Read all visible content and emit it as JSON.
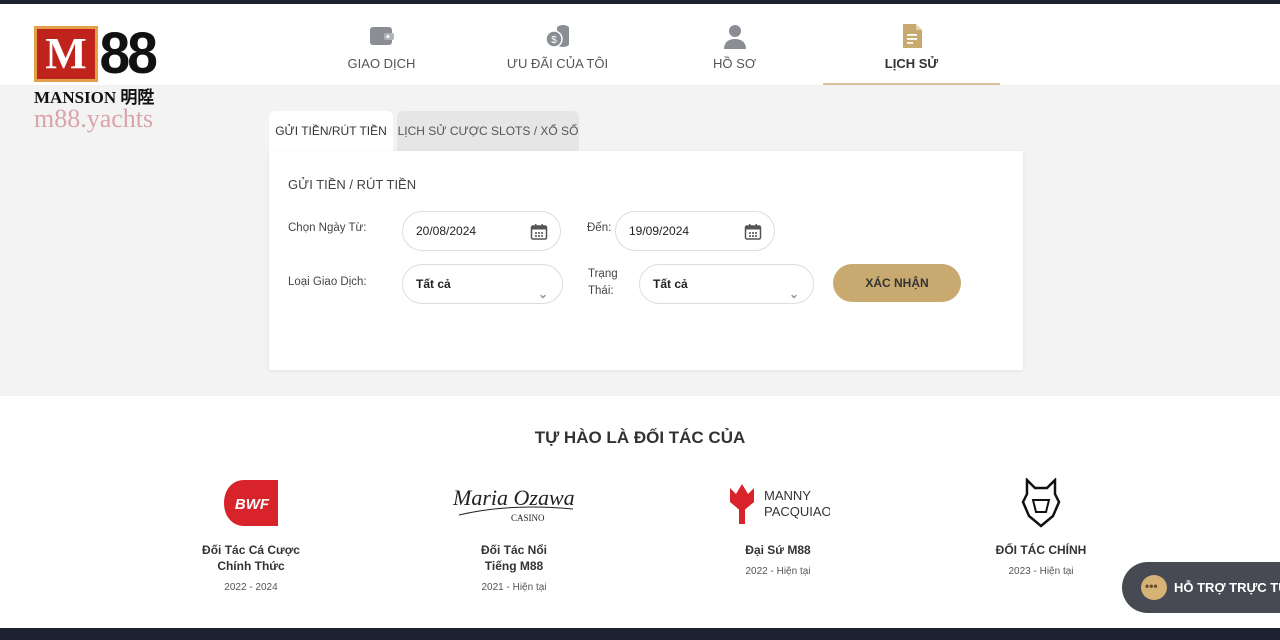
{
  "brand": {
    "logo_text": "M88",
    "sub": "MANSION 明陞",
    "url": "m88.yachts"
  },
  "nav": [
    {
      "label": "GIAO DỊCH",
      "icon": "wallet-icon"
    },
    {
      "label": "ƯU ĐÃI CỦA TÔI",
      "icon": "coins-icon"
    },
    {
      "label": "HỒ SƠ",
      "icon": "user-icon"
    },
    {
      "label": "LỊCH SỬ",
      "icon": "document-icon",
      "active": true
    }
  ],
  "tabs": [
    {
      "label": "GỬI TIỀN/RÚT TIỀN",
      "active": true
    },
    {
      "label": "LỊCH SỬ CƯỢC SLOTS / XỔ SỐ"
    }
  ],
  "form": {
    "title": "GỬI TIỀN / RÚT TIỀN",
    "from_label": "Chọn Ngày Từ:",
    "from_value": "20/08/2024",
    "to_label": "Đến:",
    "to_value": "19/09/2024",
    "type_label": "Loại Giao Dịch:",
    "type_value": "Tất cả",
    "status_label_1": "Trạng",
    "status_label_2": "Thái:",
    "status_value": "Tất cả",
    "submit": "XÁC NHẬN"
  },
  "partners": {
    "title": "TỰ HÀO LÀ ĐỐI TÁC CỦA",
    "items": [
      {
        "logo": "BWF",
        "name1": "Đối Tác Cá Cược",
        "name2": "Chính Thức",
        "years": "2022 - 2024"
      },
      {
        "logo": "Maria Ozawa CASINO",
        "name1": "Đối Tác Nổi",
        "name2": "Tiếng M88",
        "years": "2021 - Hiện tại"
      },
      {
        "logo": "MANNY PACQUIAO",
        "name1": "Đại Sứ M88",
        "name2": "",
        "years": "2022 - Hiện tại"
      },
      {
        "logo": "G2",
        "name1": "ĐỐI TÁC CHÍNH",
        "name2": "",
        "years": "2023 - Hiện tại"
      }
    ]
  },
  "support": {
    "label": "HỖ TRỢ TRỰC TUYẾN"
  },
  "colors": {
    "accent": "#c8aa70",
    "dark": "#1c2230",
    "support_bg": "#474a52"
  }
}
